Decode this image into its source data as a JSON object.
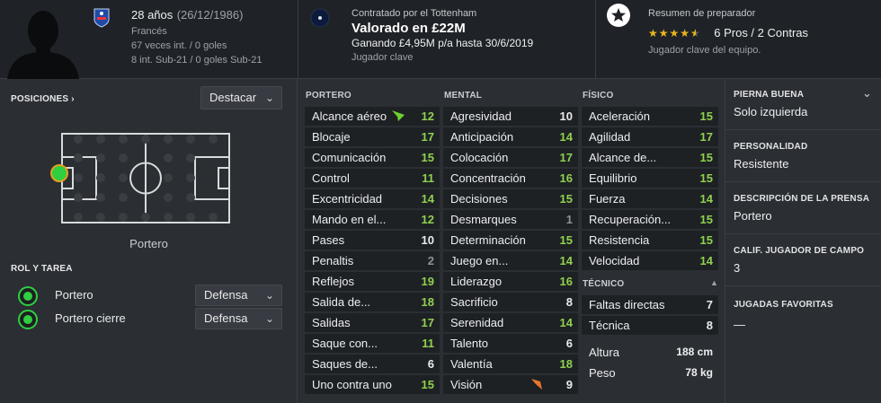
{
  "header": {
    "age": "28 años",
    "birthdate": "(26/12/1986)",
    "nationality": "Francés",
    "caps": "67 veces int. / 0 goles",
    "u21": "8 int. Sub-21 / 0 goles Sub-21",
    "contract_by": "Contratado por el Tottenham",
    "value": "Valorado en £22M",
    "wage": "Ganando £4,95M p/a hasta 30/6/2019",
    "squad_status": "Jugador clave",
    "coach_report_title": "Resumen de preparador",
    "stars": "★★★★★",
    "stars_rating": 4.5,
    "pros_cons": "6 Pros / 2 Contras",
    "coach_summary": "Jugador clave del equipo."
  },
  "positions": {
    "title": "POSICIONES ›",
    "highlight_dropdown": "Destacar",
    "position_label": "Portero"
  },
  "roles": {
    "title": "ROL Y TAREA",
    "items": [
      {
        "role": "Portero",
        "duty": "Defensa"
      },
      {
        "role": "Portero cierre",
        "duty": "Defensa"
      }
    ]
  },
  "goalkeeping": {
    "title": "PORTERO",
    "attrs": [
      {
        "name": "Alcance aéreo",
        "value": "12"
      },
      {
        "name": "Blocaje",
        "value": "17"
      },
      {
        "name": "Comunicación",
        "value": "15"
      },
      {
        "name": "Control",
        "value": "11"
      },
      {
        "name": "Excentricidad",
        "value": "14"
      },
      {
        "name": "Mando en el...",
        "value": "12"
      },
      {
        "name": "Pases",
        "value": "10"
      },
      {
        "name": "Penaltis",
        "value": "2"
      },
      {
        "name": "Reflejos",
        "value": "19"
      },
      {
        "name": "Salida de...",
        "value": "18"
      },
      {
        "name": "Salidas",
        "value": "17"
      },
      {
        "name": "Saque con...",
        "value": "11"
      },
      {
        "name": "Saques de...",
        "value": "6"
      },
      {
        "name": "Uno contra uno",
        "value": "15"
      }
    ]
  },
  "mental": {
    "title": "MENTAL",
    "attrs": [
      {
        "name": "Agresividad",
        "value": "10"
      },
      {
        "name": "Anticipación",
        "value": "14"
      },
      {
        "name": "Colocación",
        "value": "17"
      },
      {
        "name": "Concentración",
        "value": "16"
      },
      {
        "name": "Decisiones",
        "value": "15"
      },
      {
        "name": "Desmarques",
        "value": "1"
      },
      {
        "name": "Determinación",
        "value": "15"
      },
      {
        "name": "Juego en...",
        "value": "14"
      },
      {
        "name": "Liderazgo",
        "value": "16"
      },
      {
        "name": "Sacrificio",
        "value": "8"
      },
      {
        "name": "Serenidad",
        "value": "14"
      },
      {
        "name": "Talento",
        "value": "6"
      },
      {
        "name": "Valentía",
        "value": "18"
      },
      {
        "name": "Visión",
        "value": "9"
      }
    ]
  },
  "physical": {
    "title": "FÍSICO",
    "attrs": [
      {
        "name": "Aceleración",
        "value": "15"
      },
      {
        "name": "Agilidad",
        "value": "17"
      },
      {
        "name": "Alcance de...",
        "value": "15"
      },
      {
        "name": "Equilibrio",
        "value": "15"
      },
      {
        "name": "Fuerza",
        "value": "14"
      },
      {
        "name": "Recuperación...",
        "value": "15"
      },
      {
        "name": "Resistencia",
        "value": "15"
      },
      {
        "name": "Velocidad",
        "value": "14"
      }
    ]
  },
  "technical": {
    "title": "TÉCNICO",
    "attrs": [
      {
        "name": "Faltas directas",
        "value": "7"
      },
      {
        "name": "Técnica",
        "value": "8"
      }
    ]
  },
  "body": {
    "height_label": "Altura",
    "height": "188 cm",
    "weight_label": "Peso",
    "weight": "78 kg"
  },
  "info": {
    "foot_title": "PIERNA BUENA",
    "foot": "Solo izquierda",
    "personality_title": "PERSONALIDAD",
    "personality": "Resistente",
    "press_title": "DESCRIPCIÓN DE LA PRENSA",
    "press": "Portero",
    "outfield_title": "CALIF. JUGADOR DE CAMPO",
    "outfield": "3",
    "ppm_title": "JUGADAS FAVORITAS",
    "ppm": "—"
  },
  "colors": {
    "high": "#8fd14f",
    "mid": "#e9eaeb",
    "low": "#8e9297",
    "accent": "#2fcf3f"
  }
}
